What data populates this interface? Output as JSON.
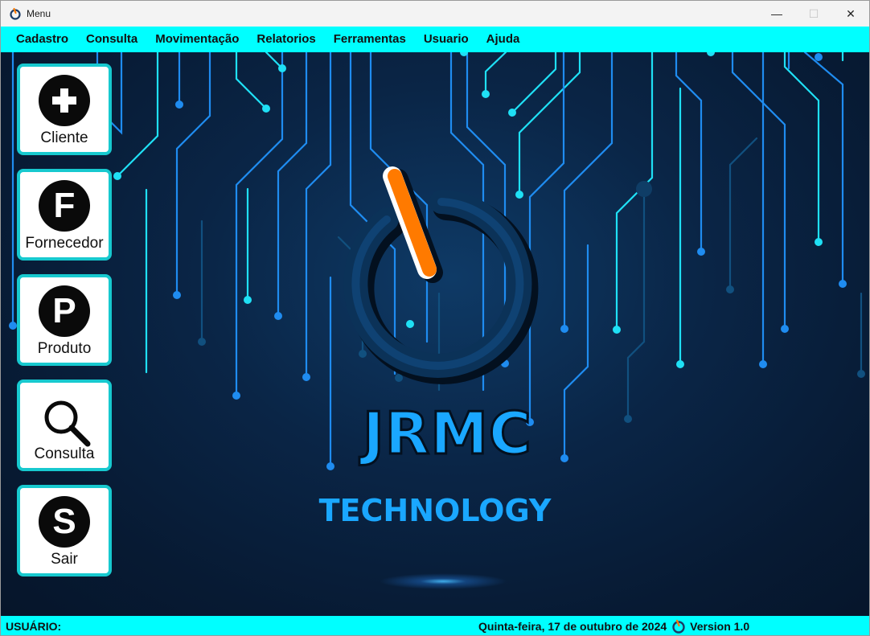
{
  "window": {
    "title": "Menu",
    "controls": {
      "minimize": "—",
      "maximize": "☐",
      "close": "✕"
    }
  },
  "menubar": {
    "items": [
      "Cadastro",
      "Consulta",
      "Movimentação",
      "Relatorios",
      "Ferramentas",
      "Usuario",
      "Ajuda"
    ]
  },
  "sidebar": {
    "buttons": [
      {
        "label": "Cliente",
        "icon": "plus-circle-icon",
        "glyph": "✚"
      },
      {
        "label": "Fornecedor",
        "icon": "f-circle-icon",
        "glyph": "F"
      },
      {
        "label": "Produto",
        "icon": "p-circle-icon",
        "glyph": "P"
      },
      {
        "label": "Consulta",
        "icon": "magnifier-icon",
        "glyph": ""
      },
      {
        "label": "Sair",
        "icon": "s-circle-icon",
        "glyph": "S"
      }
    ]
  },
  "logo": {
    "brand": "JRMC",
    "tagline": "TECHNOLOGY",
    "icon": "power-button-icon"
  },
  "statusbar": {
    "user_label": "USUÁRIO:",
    "date": "Quinta-feira, 17 de outubro de 2024",
    "version": "Version 1.0"
  },
  "colors": {
    "accent": "#00ffff",
    "button_border": "#17c9cf",
    "background": "#0a2546",
    "brand_blue": "#1aa7ff",
    "power_orange": "#ff7a00"
  }
}
